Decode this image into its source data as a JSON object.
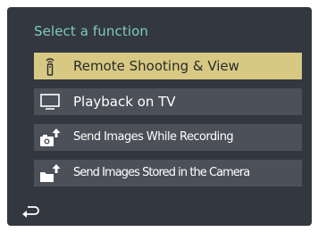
{
  "header": {
    "title": "Select a function"
  },
  "menu": {
    "items": [
      {
        "label": "Remote Shooting & View",
        "icon": "remote-antenna-icon",
        "selected": true
      },
      {
        "label": "Playback on TV",
        "icon": "tv-icon",
        "selected": false
      },
      {
        "label": "Send Images While Recording",
        "icon": "camera-send-icon",
        "selected": false
      },
      {
        "label": "Send Images Stored in the Camera",
        "icon": "folder-send-icon",
        "selected": false
      }
    ]
  },
  "footer": {
    "back_icon": "back-arrow-icon"
  },
  "colors": {
    "background": "#33373f",
    "item_background": "#4c5058",
    "selected_background": "#d7c983",
    "header_text": "#7ecbc2"
  }
}
